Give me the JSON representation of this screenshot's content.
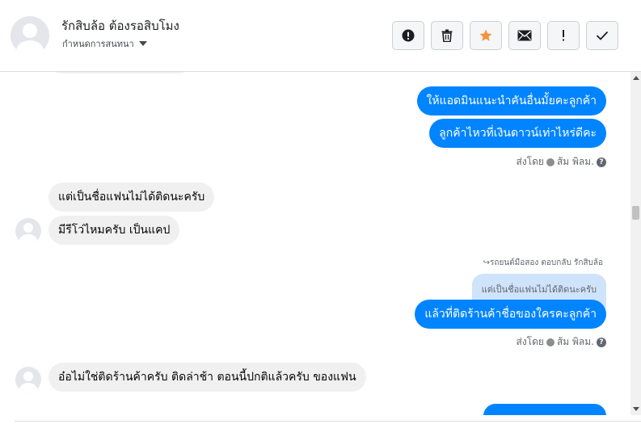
{
  "header": {
    "contact_name": "รักสิบล้อ ต้องรอสิบโมง",
    "label_selector": "กำหนดการสนทนา",
    "tools": [
      {
        "icon": "alert-circle-icon",
        "name": "mark-spam-button"
      },
      {
        "icon": "trash-icon",
        "name": "delete-button"
      },
      {
        "icon": "star-icon",
        "name": "star-button"
      },
      {
        "icon": "envelope-icon",
        "name": "mark-unread-button"
      },
      {
        "icon": "exclamation-icon",
        "name": "follow-up-button"
      },
      {
        "icon": "check-icon",
        "name": "mark-done-button"
      }
    ]
  },
  "messages": {
    "out_1": "ให้แอดมินแนะนำคันอื่นมั้ยคะลูกค้า",
    "out_2": "ลูกค้าไหวที่เงินดาวน์เท่าไหร่ดีคะ",
    "sent_by_1": "ส่งโดย",
    "sender_1": "ส้ม พิลม.",
    "in_1": "แต่เป็นชื่อแฟนไม่ได้ติดนะครับ",
    "in_2": "มีรีโว่ไหมครับ เป็นแคป",
    "reply_note": "รถยนต์มือสอง ตอบกลับ รักสิบล้อ",
    "quoted": "แต่เป็นชื่อแฟนไม่ได้ติดนะครับ",
    "out_3": "แล้วที่ติดร้านค้าชื่อของใครคะลูกค้า",
    "sent_by_2": "ส่งโดย",
    "sender_2": "ส้ม พิลม.",
    "in_3": "อ๋อไม่ใช่ติดร้านค้าครับ ติดล่าช้า ตอนนี้ปกติแล้วครับ ของแฟน"
  },
  "colors": {
    "outgoing_bubble": "#0084ff",
    "incoming_bubble": "#f0f0f0",
    "quote_bubble": "#cfe3fb",
    "star": "#f7923b"
  }
}
